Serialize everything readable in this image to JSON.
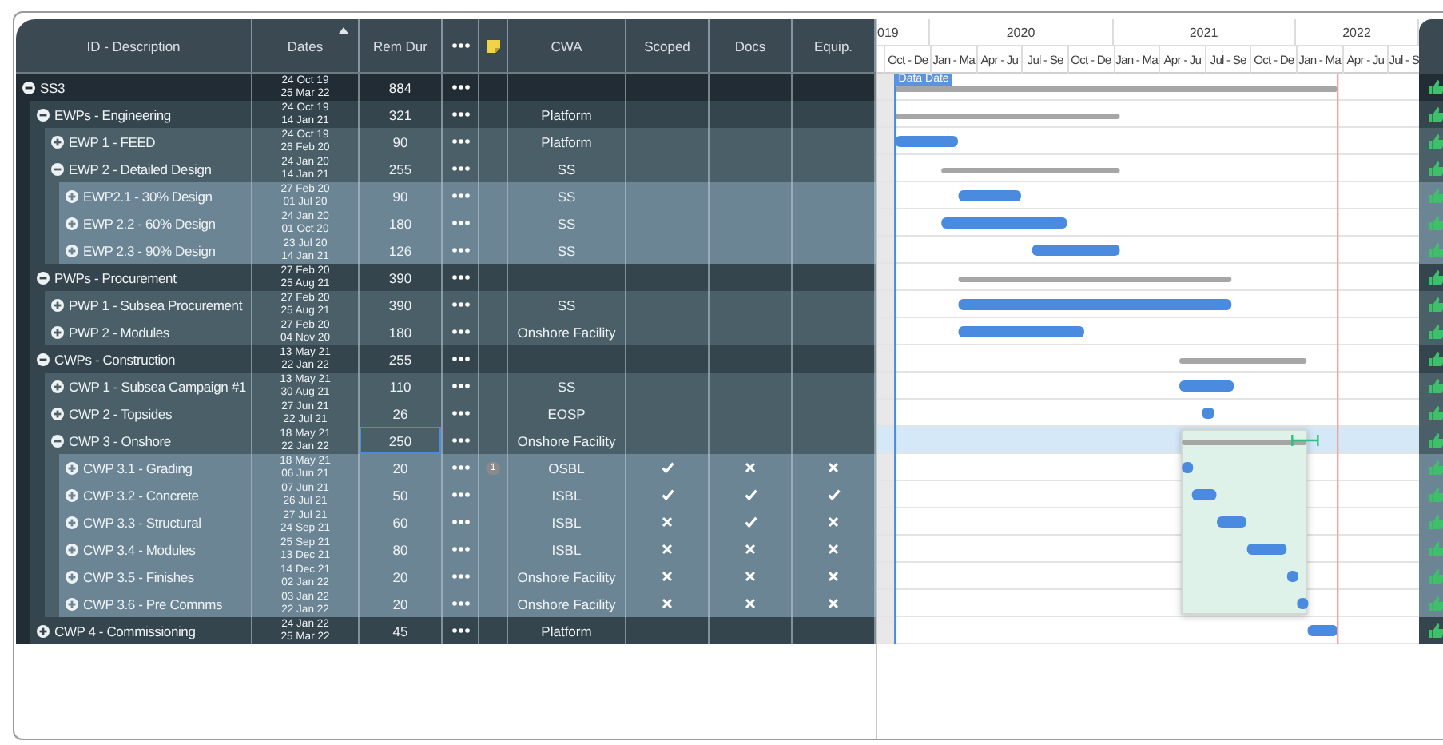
{
  "columns": [
    {
      "kind": "text",
      "label": "ID - Description",
      "sorted": false
    },
    {
      "kind": "text",
      "label": "Dates",
      "sorted": true
    },
    {
      "kind": "text",
      "label": "Rem Dur",
      "sorted": false
    },
    {
      "kind": "menu"
    },
    {
      "kind": "note"
    },
    {
      "kind": "text",
      "label": "CWA",
      "sorted": false
    },
    {
      "kind": "text",
      "label": "Scoped",
      "sorted": false
    },
    {
      "kind": "text",
      "label": "Docs",
      "sorted": false
    },
    {
      "kind": "text",
      "label": "Equip.",
      "sorted": false
    }
  ],
  "timeline": {
    "years": [
      "019",
      "2020",
      "2021",
      "2022"
    ],
    "quarters": [
      "Oct - De",
      "Jan - Ma",
      "Apr - Ju",
      "Jul - Se",
      "Oct - De",
      "Jan - Ma",
      "Apr - Ju",
      "Jul - Se",
      "Oct - De",
      "Jan - Ma",
      "Apr - Ju",
      "Jul - S"
    ],
    "data_date_label": "Data Date"
  },
  "rows": [
    {
      "id_description": "SS3",
      "start": "24 Oct 19",
      "finish": "25 Mar 22",
      "rem_dur": "884",
      "expanded": true,
      "selected": false,
      "children": [
        {
          "id_description": "EWPs - Engineering",
          "start": "24 Oct 19",
          "finish": "14 Jan 21",
          "rem_dur": "321",
          "cwa": "Platform",
          "expanded": true,
          "selected": false,
          "children": [
            {
              "id_description": "EWP 1 - FEED",
              "start": "24 Oct 19",
              "finish": "26 Feb 20",
              "rem_dur": "90",
              "cwa": "Platform",
              "expanded": false,
              "selected": false
            },
            {
              "id_description": "EWP 2 - Detailed Design",
              "start": "24 Jan 20",
              "finish": "14 Jan 21",
              "rem_dur": "255",
              "cwa": "SS",
              "expanded": true,
              "selected": false,
              "children": [
                {
                  "id_description": "EWP2.1 - 30% Design",
                  "start": "27 Feb 20",
                  "finish": "01 Jul 20",
                  "rem_dur": "90",
                  "cwa": "SS",
                  "expanded": false,
                  "selected": false
                },
                {
                  "id_description": "EWP 2.2 - 60% Design",
                  "start": "24 Jan 20",
                  "finish": "01 Oct 20",
                  "rem_dur": "180",
                  "cwa": "SS",
                  "expanded": false,
                  "selected": false
                },
                {
                  "id_description": "EWP 2.3 - 90% Design",
                  "start": "23 Jul 20",
                  "finish": "14 Jan 21",
                  "rem_dur": "126",
                  "cwa": "SS",
                  "expanded": false,
                  "selected": false
                }
              ]
            }
          ]
        },
        {
          "id_description": "PWPs - Procurement",
          "start": "27 Feb 20",
          "finish": "25 Aug 21",
          "rem_dur": "390",
          "expanded": true,
          "selected": false,
          "children": [
            {
              "id_description": "PWP 1 - Subsea Procurement",
              "start": "27 Feb 20",
              "finish": "25 Aug 21",
              "rem_dur": "390",
              "cwa": "SS",
              "expanded": false,
              "selected": false
            },
            {
              "id_description": "PWP 2 - Modules",
              "start": "27 Feb 20",
              "finish": "04 Nov 20",
              "rem_dur": "180",
              "cwa": "Onshore Facility",
              "expanded": false,
              "selected": false
            }
          ]
        },
        {
          "id_description": "CWPs - Construction",
          "start": "13 May 21",
          "finish": "22 Jan 22",
          "rem_dur": "255",
          "expanded": true,
          "selected": false,
          "children": [
            {
              "id_description": "CWP 1 - Subsea Campaign #1",
              "start": "13 May 21",
              "finish": "30 Aug 21",
              "rem_dur": "110",
              "cwa": "SS",
              "expanded": false,
              "selected": false
            },
            {
              "id_description": "CWP 2 - Topsides",
              "start": "27 Jun 21",
              "finish": "22 Jul 21",
              "rem_dur": "26",
              "cwa": "EOSP",
              "expanded": false,
              "selected": false
            },
            {
              "id_description": "CWP 3 - Onshore",
              "start": "18 May 21",
              "finish": "22 Jan 22",
              "rem_dur": "250",
              "cwa": "Onshore Facility",
              "expanded": true,
              "selected": true,
              "children": [
                {
                  "id_description": "CWP 3.1 - Grading",
                  "start": "18 May 21",
                  "finish": "06 Jun 21",
                  "rem_dur": "20",
                  "note_count": "1",
                  "cwa": "OSBL",
                  "scoped": true,
                  "docs": false,
                  "equip": false,
                  "expanded": false,
                  "selected": false
                },
                {
                  "id_description": "CWP 3.2 - Concrete",
                  "start": "07 Jun 21",
                  "finish": "26 Jul 21",
                  "rem_dur": "50",
                  "cwa": "ISBL",
                  "scoped": true,
                  "docs": true,
                  "equip": true,
                  "expanded": false,
                  "selected": false
                },
                {
                  "id_description": "CWP 3.3 - Structural",
                  "start": "27 Jul 21",
                  "finish": "24 Sep 21",
                  "rem_dur": "60",
                  "cwa": "ISBL",
                  "scoped": false,
                  "docs": true,
                  "equip": false,
                  "expanded": false,
                  "selected": false
                },
                {
                  "id_description": "CWP 3.4 - Modules",
                  "start": "25 Sep 21",
                  "finish": "13 Dec 21",
                  "rem_dur": "80",
                  "cwa": "ISBL",
                  "scoped": false,
                  "docs": false,
                  "equip": false,
                  "expanded": false,
                  "selected": false
                },
                {
                  "id_description": "CWP 3.5 - Finishes",
                  "start": "14 Dec 21",
                  "finish": "02 Jan 22",
                  "rem_dur": "20",
                  "cwa": "Onshore Facility",
                  "scoped": false,
                  "docs": false,
                  "equip": false,
                  "expanded": false,
                  "selected": false
                },
                {
                  "id_description": "CWP 3.6 - Pre Comnms",
                  "start": "03 Jan 22",
                  "finish": "22 Jan 22",
                  "rem_dur": "20",
                  "cwa": "Onshore Facility",
                  "scoped": false,
                  "docs": false,
                  "equip": false,
                  "expanded": false,
                  "selected": false
                }
              ]
            }
          ]
        },
        {
          "id_description": "CWP 4 - Commissioning",
          "start": "24 Jan 22",
          "finish": "25 Mar 22",
          "rem_dur": "45",
          "cwa": "Platform",
          "expanded": false,
          "selected": false
        }
      ]
    }
  ]
}
